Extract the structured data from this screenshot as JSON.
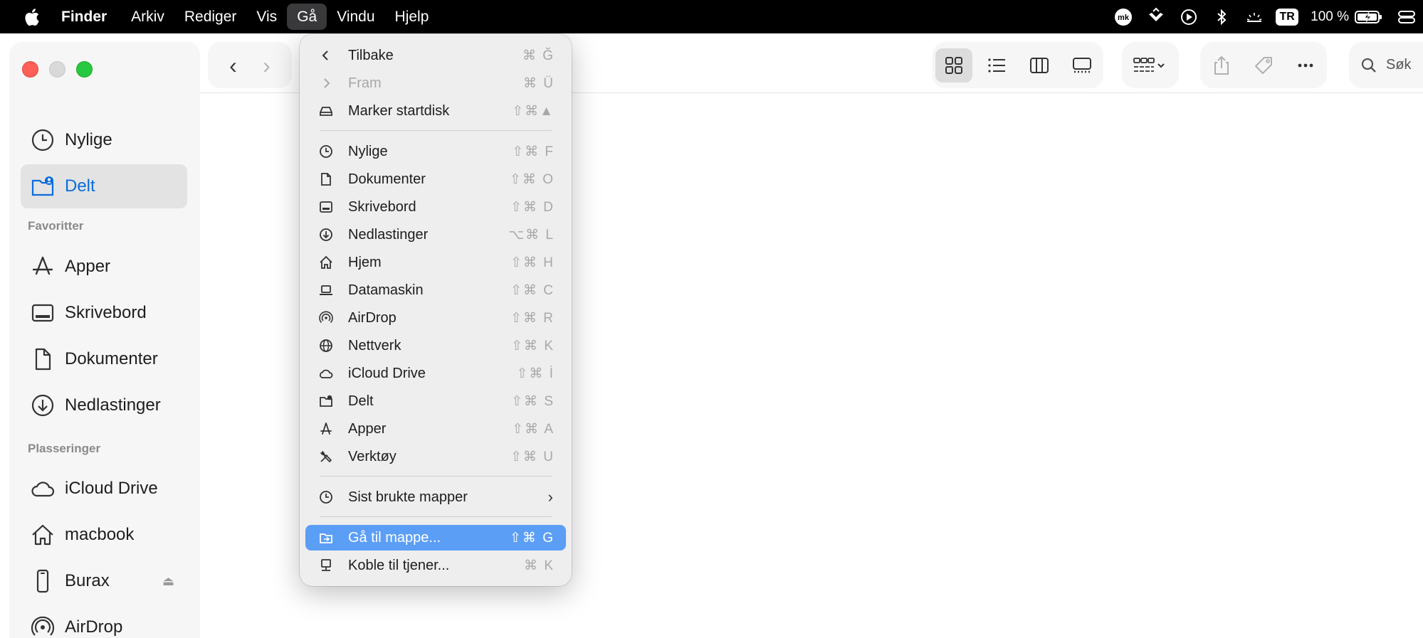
{
  "menubar": {
    "app": "Finder",
    "items": [
      "Arkiv",
      "Rediger",
      "Vis",
      "Gå",
      "Vindu",
      "Hjelp"
    ],
    "active_index": 3,
    "badge": "TR",
    "battery": "100 %",
    "icons": [
      "apple-icon",
      "mk-icon",
      "drop-icon",
      "play-circle-icon",
      "bluetooth-icon",
      "brightness-icon",
      "battery-icon",
      "control-center-icon"
    ]
  },
  "sidebar": {
    "top_items": [
      {
        "label": "Nylige",
        "icon": "clock-icon"
      },
      {
        "label": "Delt",
        "icon": "shared-folder-icon",
        "selected": true
      }
    ],
    "favorites_heading": "Favoritter",
    "favorites": [
      {
        "label": "Apper",
        "icon": "apps-icon"
      },
      {
        "label": "Skrivebord",
        "icon": "desktop-icon"
      },
      {
        "label": "Dokumenter",
        "icon": "document-icon"
      },
      {
        "label": "Nedlastinger",
        "icon": "download-icon"
      }
    ],
    "locations_heading": "Plasseringer",
    "locations": [
      {
        "label": "iCloud Drive",
        "icon": "cloud-icon"
      },
      {
        "label": "macbook",
        "icon": "home-icon"
      },
      {
        "label": "Burax",
        "icon": "phone-icon",
        "eject": "⏏"
      },
      {
        "label": "AirDrop",
        "icon": "airdrop-icon"
      }
    ]
  },
  "toolbar": {
    "back": "‹",
    "forward": "›",
    "search_label": "Søk"
  },
  "go_menu": {
    "groups": [
      [
        {
          "label": "Tilbake",
          "shortcut": "⌘ Ğ",
          "icon": "chevron-left-icon"
        },
        {
          "label": "Fram",
          "shortcut": "⌘ Ü",
          "icon": "chevron-right-icon",
          "disabled": true
        },
        {
          "label": "Marker startdisk",
          "shortcut": "⇧⌘▲",
          "icon": "disk-icon"
        }
      ],
      [
        {
          "label": "Nylige",
          "shortcut": "⇧⌘ F",
          "icon": "clock-icon"
        },
        {
          "label": "Dokumenter",
          "shortcut": "⇧⌘ O",
          "icon": "document-icon"
        },
        {
          "label": "Skrivebord",
          "shortcut": "⇧⌘ D",
          "icon": "desktop-icon"
        },
        {
          "label": "Nedlastinger",
          "shortcut": "⌥⌘ L",
          "icon": "download-icon"
        },
        {
          "label": "Hjem",
          "shortcut": "⇧⌘ H",
          "icon": "home-icon"
        },
        {
          "label": "Datamaskin",
          "shortcut": "⇧⌘ C",
          "icon": "laptop-icon"
        },
        {
          "label": "AirDrop",
          "shortcut": "⇧⌘ R",
          "icon": "airdrop-icon"
        },
        {
          "label": "Nettverk",
          "shortcut": "⇧⌘ K",
          "icon": "globe-icon"
        },
        {
          "label": "iCloud Drive",
          "shortcut": "⇧⌘ İ",
          "icon": "cloud-icon"
        },
        {
          "label": "Delt",
          "shortcut": "⇧⌘ S",
          "icon": "shared-folder-icon"
        },
        {
          "label": "Apper",
          "shortcut": "⇧⌘ A",
          "icon": "apps-icon"
        },
        {
          "label": "Verktøy",
          "shortcut": "⇧⌘ U",
          "icon": "tools-icon"
        }
      ],
      [
        {
          "label": "Sist brukte mapper",
          "submenu": "›",
          "icon": "clock-icon"
        }
      ],
      [
        {
          "label": "Gå til mappe...",
          "shortcut": "⇧⌘ G",
          "icon": "folder-arrow-icon",
          "highlighted": true
        },
        {
          "label": "Koble til tjener...",
          "shortcut": "⌘ K",
          "icon": "server-icon"
        }
      ]
    ]
  },
  "colors": {
    "accent": "#0a6cdb",
    "highlight": "#5b9ef5",
    "close": "#ff5f57",
    "zoom": "#28c840"
  }
}
